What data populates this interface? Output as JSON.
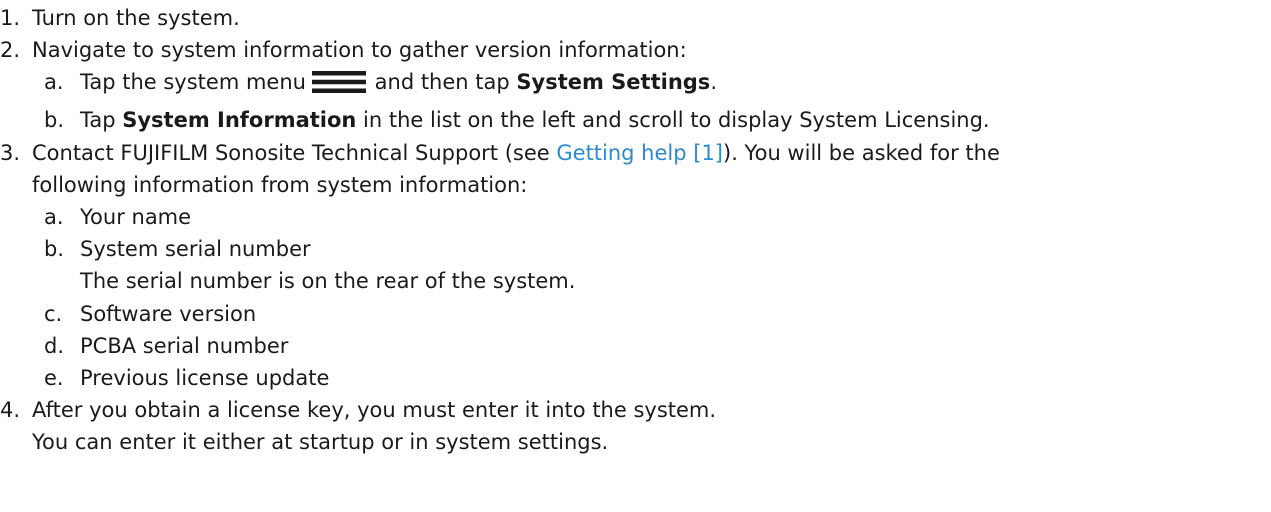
{
  "steps": [
    {
      "num": "1.",
      "text": "Turn on the system."
    },
    {
      "num": "2.",
      "text": "Navigate to system information to gather version information:",
      "sub": [
        {
          "num": "a.",
          "pre": "Tap the system menu",
          "mid": " and then tap ",
          "bold": "System Settings",
          "post": "."
        },
        {
          "num": "b.",
          "pre": "Tap ",
          "bold": "System Information",
          "post": " in the list on the left and scroll to display System Licensing."
        }
      ]
    },
    {
      "num": "3.",
      "pre": "Contact FUJIFILM Sonosite Technical Support (see ",
      "link": "Getting help [1]",
      "post": "). You will be asked for the",
      "cont": "following information from system information:",
      "sub": [
        {
          "num": "a.",
          "text": "Your name"
        },
        {
          "num": "b.",
          "text": "System serial number",
          "note": "The serial number is on the rear of the system."
        },
        {
          "num": "c.",
          "text": "Software version"
        },
        {
          "num": "d.",
          "text": "PCBA serial number"
        },
        {
          "num": "e.",
          "text": "Previous license update"
        }
      ]
    },
    {
      "num": "4.",
      "text": "After you obtain a license key, you must enter it into the system.",
      "cont": "You can enter it either at startup or in system settings."
    }
  ],
  "icons": {
    "system_menu": "hamburger-menu-icon"
  },
  "colors": {
    "link": "#2b8ad0",
    "text": "#1a1a1a"
  }
}
